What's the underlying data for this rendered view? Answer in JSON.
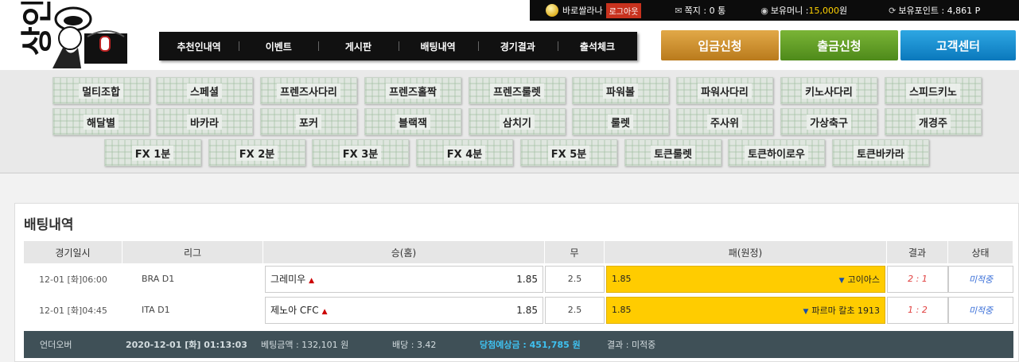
{
  "header": {
    "logo_text": "상인",
    "user_name": "바로쌀라나",
    "logout_label": "로그아웃",
    "messages_label": "쪽지 : 0 통",
    "money_label": "보유머니 : ",
    "money_value": "15,000",
    "money_unit": " 원",
    "points_label": "보유포인트 : 4,861 P"
  },
  "nav": [
    "추천인내역",
    "이벤트",
    "게시판",
    "배팅내역",
    "경기결과",
    "출석체크"
  ],
  "actions": {
    "deposit": "입금신청",
    "withdraw": "출금신청",
    "support": "고객센터"
  },
  "games": {
    "row1": [
      "멀티조합",
      "스페셜",
      "프렌즈사다리",
      "프렌즈홀짝",
      "프렌즈룰렛",
      "파워볼",
      "파워사다리",
      "키노사다리",
      "스피드키노"
    ],
    "row2": [
      "해달별",
      "바카라",
      "포커",
      "블랙잭",
      "삼치기",
      "룰렛",
      "주사위",
      "가상축구",
      "개경주"
    ],
    "row3": [
      "FX 1분",
      "FX 2분",
      "FX 3분",
      "FX 4분",
      "FX 5분",
      "토큰룰렛",
      "토큰하이로우",
      "토큰바카라"
    ]
  },
  "betting": {
    "title": "배팅내역",
    "columns": [
      "경기일시",
      "리그",
      "승(홈)",
      "무",
      "패(원정)",
      "결과",
      "상태"
    ],
    "rows": [
      {
        "date": "12-01 [화]06:00",
        "league": "BRA D1",
        "home": "그레미우",
        "home_odds": "1.85",
        "draw": "2.5",
        "away_odds": "1.85",
        "away": "고이아스",
        "result": "2 : 1",
        "status": "미적중"
      },
      {
        "date": "12-01 [화]04:45",
        "league": "ITA D1",
        "home": "제노아 CFC",
        "home_odds": "1.85",
        "draw": "2.5",
        "away_odds": "1.85",
        "away": "파르마 칼초 1913",
        "result": "1 : 2",
        "status": "미적중"
      }
    ],
    "summary": {
      "type": "언더오버",
      "datetime": "2020-12-01 [화] 01:13:03",
      "amount": "베팅금액 : 132,101 원",
      "odds": "배당 : 3.42",
      "expected": "당첨예상금 : 451,785 원",
      "result": "결과 : 미적중"
    }
  }
}
